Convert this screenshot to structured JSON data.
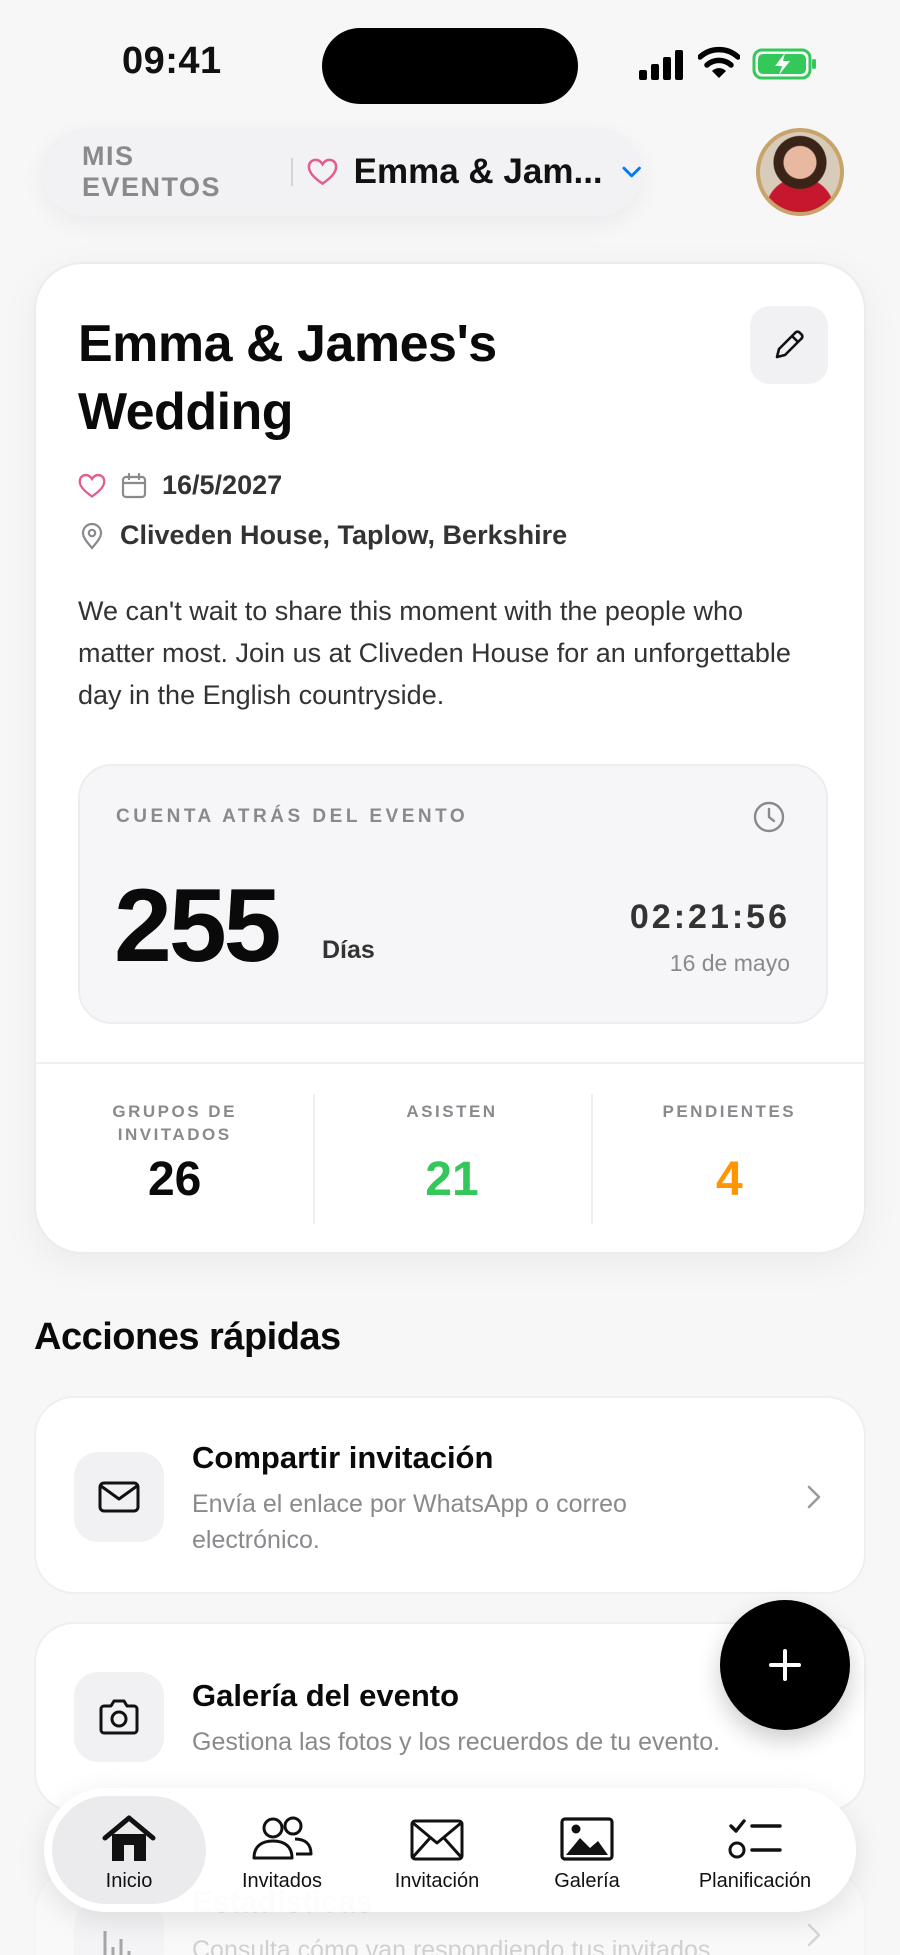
{
  "status_bar": {
    "time": "09:41"
  },
  "switcher": {
    "label": "MIS EVENTOS",
    "event_name": "Emma & Jam..."
  },
  "event": {
    "title": "Emma & James's Wedding",
    "date": "16/5/2027",
    "location": "Cliveden House, Taplow, Berkshire",
    "description": "We can't wait to share this moment with the people who matter most. Join us at Cliveden House for an unforgettable day in the English countryside."
  },
  "countdown": {
    "label": "CUENTA ATRÁS DEL EVENTO",
    "days": "255",
    "days_label": "Días",
    "time": "02:21:56",
    "date": "16 de mayo"
  },
  "stats": [
    {
      "label": "GRUPOS DE INVITADOS",
      "value": "26",
      "color": "#0a0a0a"
    },
    {
      "label": "ASISTEN",
      "value": "21",
      "color": "#34c759"
    },
    {
      "label": "PENDIENTES",
      "value": "4",
      "color": "#ff9500"
    }
  ],
  "quick_actions": {
    "title": "Acciones rápidas",
    "items": [
      {
        "title": "Compartir invitación",
        "subtitle": "Envía el enlace por WhatsApp o correo electrónico.",
        "icon": "envelope-icon"
      },
      {
        "title": "Galería del evento",
        "subtitle": "Gestiona las fotos y los recuerdos de tu evento.",
        "icon": "camera-icon"
      },
      {
        "title": "Estadísticas",
        "subtitle": "Consulta cómo van respondiendo tus invitados",
        "icon": "bar-chart-icon"
      }
    ]
  },
  "tabbar": [
    {
      "label": "Inicio",
      "icon": "home-icon",
      "active": true
    },
    {
      "label": "Invitados",
      "icon": "people-icon",
      "active": false
    },
    {
      "label": "Invitación",
      "icon": "envelope-icon",
      "active": false
    },
    {
      "label": "Galería",
      "icon": "image-icon",
      "active": false
    },
    {
      "label": "Planificación",
      "icon": "checklist-icon",
      "active": false
    }
  ],
  "colors": {
    "accent_pink": "#e35d8a",
    "accent_blue": "#007aff",
    "battery_green": "#34c759"
  }
}
